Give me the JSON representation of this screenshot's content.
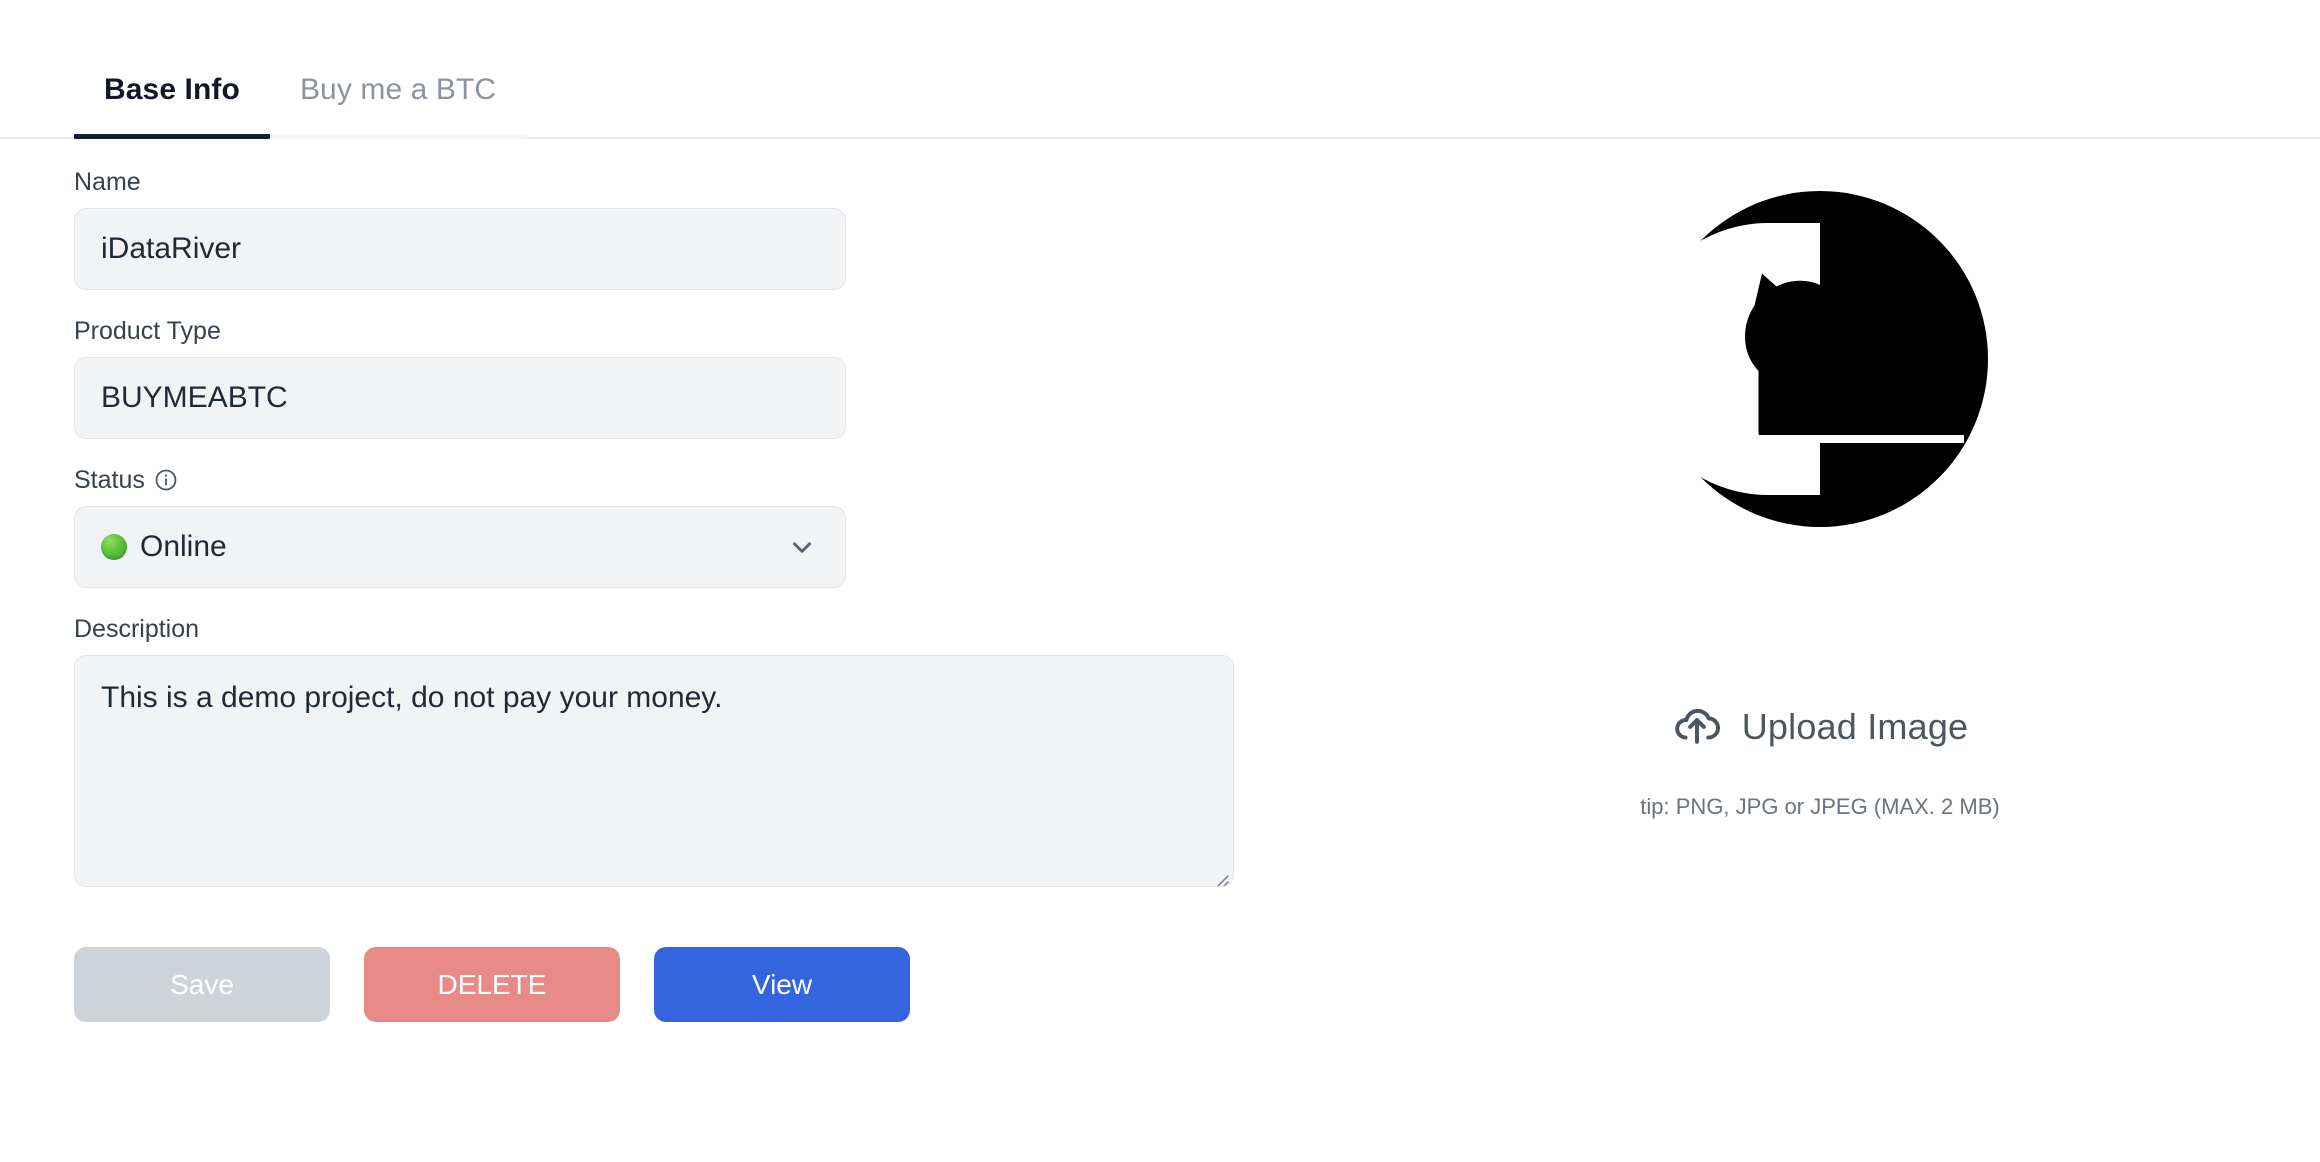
{
  "tabs": [
    {
      "label": "Base Info",
      "active": true
    },
    {
      "label": "Buy me a BTC",
      "active": false
    }
  ],
  "form": {
    "name": {
      "label": "Name",
      "value": "iDataRiver"
    },
    "product_type": {
      "label": "Product Type",
      "value": "BUYMEABTC"
    },
    "status": {
      "label": "Status",
      "info_icon": "info-circle-icon",
      "value": "Online",
      "dot_color": "#5cc13a",
      "chevron_icon": "chevron-down-icon"
    },
    "description": {
      "label": "Description",
      "value": "This is a demo project, do not pay your money."
    }
  },
  "actions": {
    "save": {
      "label": "Save",
      "color": "#ced3d9",
      "disabled": true
    },
    "delete": {
      "label": "DELETE",
      "color": "#e88a87"
    },
    "view": {
      "label": "View",
      "color": "#3464e0"
    }
  },
  "media": {
    "logo_icon": "cat-in-circle-logo",
    "upload": {
      "icon": "cloud-upload-icon",
      "label": "Upload Image"
    },
    "tip": "tip: PNG, JPG or JPEG (MAX. 2 MB)"
  }
}
